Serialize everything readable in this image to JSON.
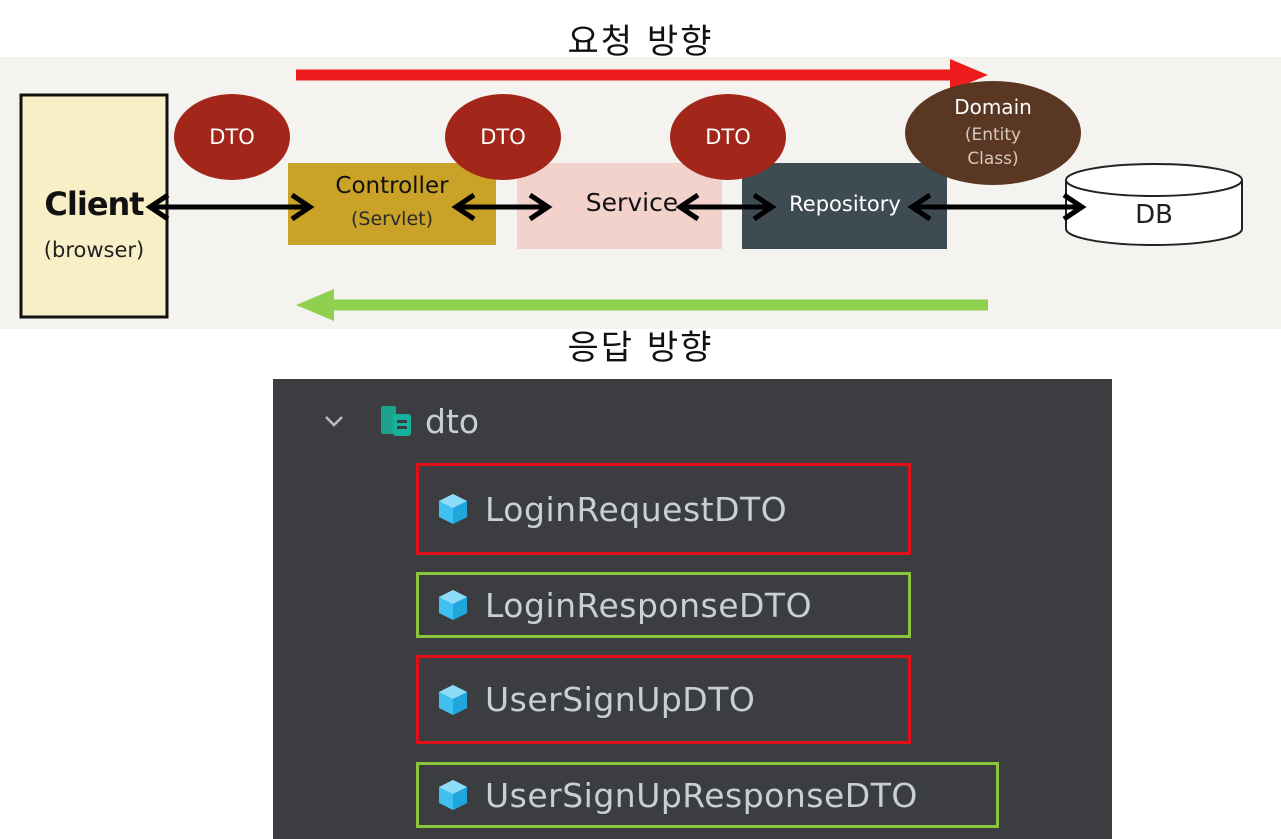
{
  "captions": {
    "request": "요청 방향",
    "response": "응답 방향"
  },
  "architecture": {
    "client": {
      "title": "Client",
      "subtitle": "(browser)"
    },
    "controller": {
      "title": "Controller",
      "subtitle": "(Servlet)"
    },
    "service": {
      "title": "Service"
    },
    "repository": {
      "title": "Repository"
    },
    "domain": {
      "title": "Domain",
      "line2": "(Entity",
      "line3": "Class)"
    },
    "db": {
      "title": "DB"
    },
    "dto_badges": [
      "DTO",
      "DTO",
      "DTO"
    ]
  },
  "colors": {
    "request_arrow": "#ee1c1c",
    "response_arrow": "#8fd14f",
    "client_fill": "#f8efc6",
    "controller_fill": "#c9a227",
    "service_fill": "#f3d2cc",
    "repository_fill": "#3f4b53",
    "dto_fill": "#a3261a",
    "domain_fill": "#5a3722",
    "panel_bg": "#3b3d40",
    "highlight_request": "#e0101a",
    "highlight_response": "#8cc63f",
    "class_icon": "#3fc0f0",
    "folder_icon": "#1aa38a"
  },
  "file_tree": {
    "folder": {
      "name": "dto",
      "icon": "package-folder-icon",
      "expanded": true
    },
    "items": [
      {
        "name": "LoginRequestDTO",
        "icon": "class-icon",
        "highlight": "request"
      },
      {
        "name": "LoginResponseDTO",
        "icon": "class-icon",
        "highlight": "response"
      },
      {
        "name": "UserSignUpDTO",
        "icon": "class-icon",
        "highlight": "request"
      },
      {
        "name": "UserSignUpResponseDTO",
        "icon": "class-icon",
        "highlight": "response"
      }
    ]
  }
}
